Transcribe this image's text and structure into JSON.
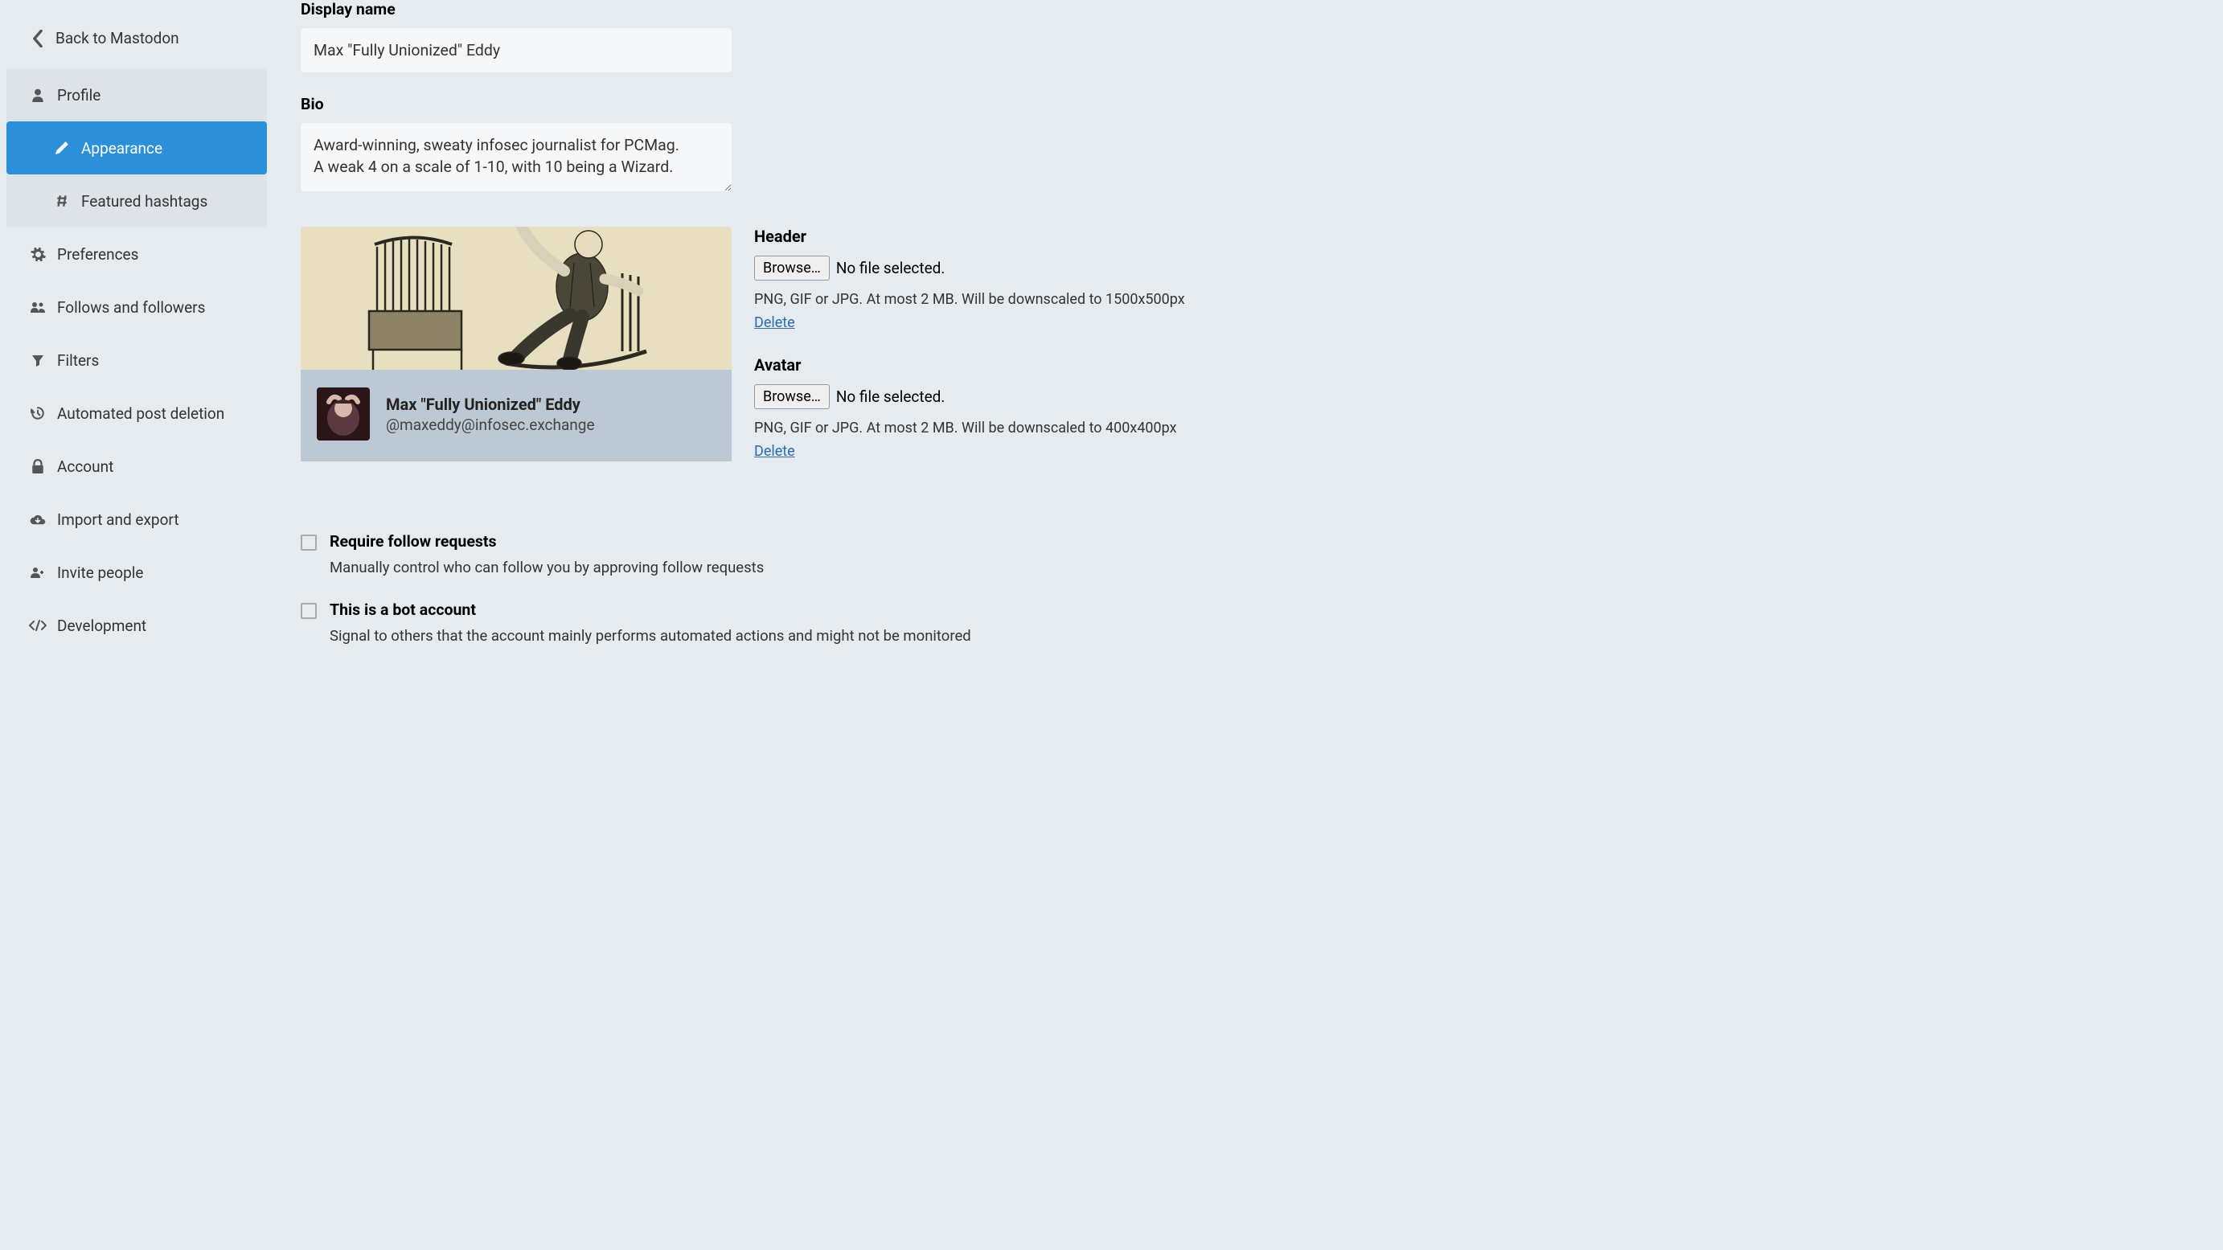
{
  "nav": {
    "back": "Back to Mastodon",
    "profile": "Profile",
    "appearance": "Appearance",
    "featured_hashtags": "Featured hashtags",
    "preferences": "Preferences",
    "follows": "Follows and followers",
    "filters": "Filters",
    "automated": "Automated post deletion",
    "account": "Account",
    "import_export": "Import and export",
    "invite": "Invite people",
    "development": "Development"
  },
  "labels": {
    "display_name": "Display name",
    "bio": "Bio",
    "header": "Header",
    "avatar": "Avatar"
  },
  "fields": {
    "display_name": "Max \"Fully Unionized\" Eddy",
    "bio": "Award-winning, sweaty infosec journalist for PCMag.\nA weak 4 on a scale of 1-10, with 10 being a Wizard."
  },
  "preview": {
    "name": "Max \"Fully Unionized\" Eddy",
    "handle": "@maxeddy@infosec.exchange"
  },
  "upload": {
    "browse": "Browse…",
    "no_file": "No file selected.",
    "header_hint": "PNG, GIF or JPG. At most 2 MB. Will be downscaled to 1500x500px",
    "avatar_hint": "PNG, GIF or JPG. At most 2 MB. Will be downscaled to 400x400px",
    "delete": "Delete"
  },
  "checks": {
    "require_follow_label": "Require follow requests",
    "require_follow_desc": "Manually control who can follow you by approving follow requests",
    "bot_label": "This is a bot account",
    "bot_desc": "Signal to others that the account mainly performs automated actions and might not be monitored"
  }
}
